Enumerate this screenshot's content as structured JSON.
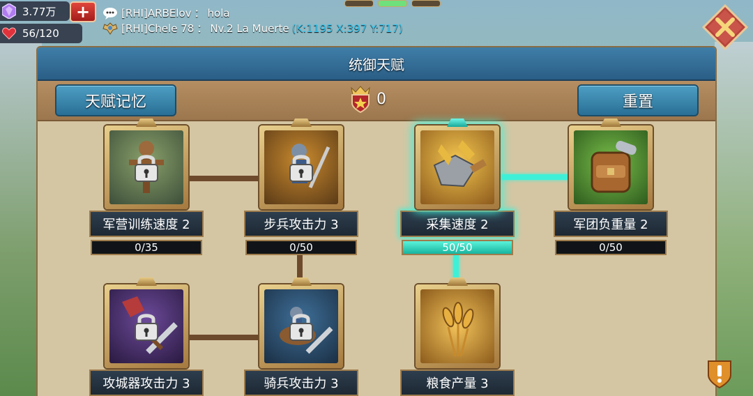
{
  "resources": {
    "gems": "3.77万",
    "stamina": "56/120"
  },
  "chat": [
    {
      "prefix": "[RHI]ARBElov",
      "sep": "：",
      "text": "hola",
      "coord": ""
    },
    {
      "prefix": "[RHI]Chele 78",
      "sep": "：",
      "text": "Nv.2 La Muerte",
      "coord": "(K:1195 X:397 Y:717)"
    }
  ],
  "panel": {
    "title": "统御天赋",
    "memory_button": "天赋记忆",
    "reset_button": "重置",
    "points": "0"
  },
  "talents": [
    {
      "id": "barracks",
      "label": "军营训练速度 2",
      "progress": "0/35",
      "fill": 0,
      "locked": true,
      "active": false
    },
    {
      "id": "infantry",
      "label": "步兵攻击力 3",
      "progress": "0/50",
      "fill": 0,
      "locked": true,
      "active": false
    },
    {
      "id": "gather",
      "label": "采集速度 2",
      "progress": "50/50",
      "fill": 1,
      "locked": false,
      "active": true
    },
    {
      "id": "load",
      "label": "军团负重量 2",
      "progress": "0/50",
      "fill": 0,
      "locked": false,
      "active": false
    },
    {
      "id": "siege",
      "label": "攻城器攻击力 3",
      "progress": "",
      "fill": 0,
      "locked": true,
      "active": false
    },
    {
      "id": "cavalry",
      "label": "骑兵攻击力 3",
      "progress": "",
      "fill": 0,
      "locked": true,
      "active": false
    },
    {
      "id": "food",
      "label": "粮食产量 3",
      "progress": "",
      "fill": 0,
      "locked": false,
      "active": false
    }
  ],
  "colors": {
    "accent_active": "#3ff0d8",
    "panel_title_bg": "#2a5e86",
    "button_blue": "#2a6f95",
    "close_red": "#b8443c"
  }
}
